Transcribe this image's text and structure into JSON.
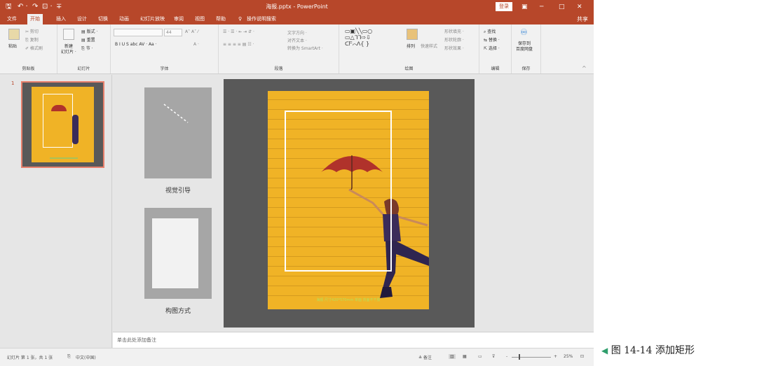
{
  "window": {
    "title": "海报.pptx - PowerPoint",
    "login_label": "登录",
    "share_label": "共享",
    "ribbon_display_icon": "ribbon-display-icon",
    "minimize": "─",
    "maximize": "□",
    "close": "✕"
  },
  "quick_access": {
    "save": "🖫",
    "undo": "↶ ·",
    "redo": "↷",
    "start": "⊡ ·",
    "more": "∓"
  },
  "tabs": [
    "文件",
    "开始",
    "插入",
    "设计",
    "切换",
    "动画",
    "幻灯片放映",
    "审阅",
    "视图",
    "帮助",
    "操作说明搜索"
  ],
  "active_tab": "开始",
  "ribbon": {
    "clipboard": {
      "label": "剪贴板",
      "paste": "粘贴",
      "cut": "✂ 剪切",
      "copy": "⎘ 复制",
      "format_painter": "✐ 格式刷"
    },
    "slides": {
      "label": "幻灯片",
      "new_slide": "新建",
      "new_slide_2": "幻灯片 ·",
      "layout": "▤ 版式 ·",
      "reset": "▤ 重置",
      "section": "⎘ 节 ·"
    },
    "font": {
      "label": "字体",
      "size": "44",
      "buttons": "B  I  U  S  abc  AV ·  Aa ·",
      "color": "A ·"
    },
    "paragraph": {
      "label": "段落",
      "text_direction": "文字方向 ·",
      "align_text": "对齐文本 ·",
      "smartart": "转换为 SmartArt ·"
    },
    "drawing": {
      "label": "绘图",
      "arrange": "排列",
      "quick_styles": "快速样式",
      "fill": "形状填充 ·",
      "outline": "形状轮廓 ·",
      "effects": "形状效果 ·"
    },
    "editing": {
      "label": "编辑",
      "find": "查找",
      "replace": "替换 ·",
      "select": "选择 ·"
    },
    "save": {
      "label": "保存",
      "save_to": "保存到",
      "baidu": "百度网盘"
    }
  },
  "thumbnail": {
    "slide_number": "1"
  },
  "reference": [
    {
      "label": "视觉引导"
    },
    {
      "label": "构图方式"
    }
  ],
  "slide": {
    "caption": "海报 尺寸420*570mm 单面 背面不干胶"
  },
  "notes": {
    "placeholder": "单击此处添加备注"
  },
  "status": {
    "slide_info": "幻灯片 第 1 张，共 1 张",
    "language": "中文(中国)",
    "notes_btn": "≜ 备注",
    "zoom_minus": "-",
    "zoom_plus": "+",
    "zoom": "25%"
  },
  "figure": {
    "caption": "图 14-14   添加矩形",
    "arrow": "◀"
  },
  "colors": {
    "accent": "#b7472a",
    "poster_yellow": "#f0b326",
    "slide_bg": "#595959",
    "reference_gray": "#a6a6a6"
  }
}
